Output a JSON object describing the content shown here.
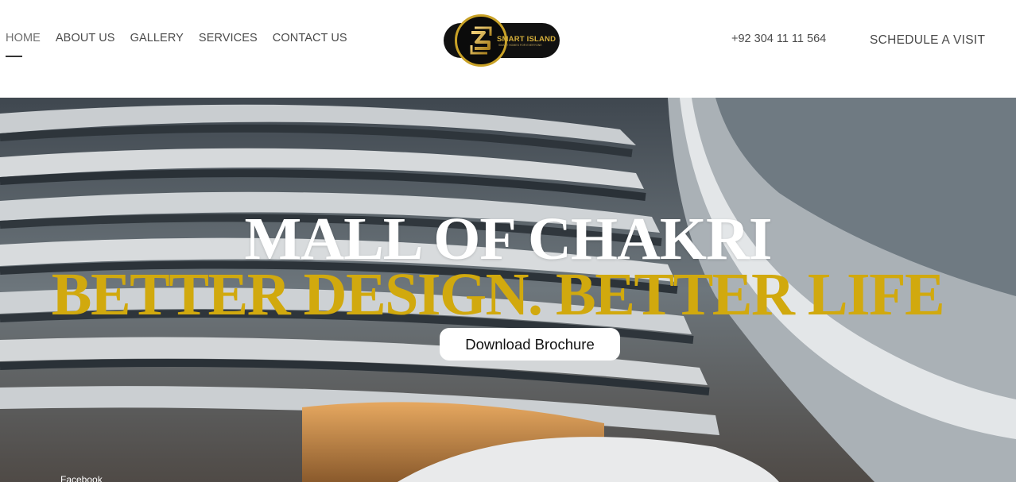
{
  "nav": {
    "items": [
      {
        "label": "HOME",
        "active": true
      },
      {
        "label": "ABOUT US",
        "active": false
      },
      {
        "label": "GALLERY",
        "active": false
      },
      {
        "label": "SERVICES",
        "active": false
      },
      {
        "label": "CONTACT US",
        "active": false
      }
    ]
  },
  "logo": {
    "name": "SMART ISLAND",
    "tagline": "SMART HOMES FOR EVERYONE",
    "icon": "smart-island-logo-icon"
  },
  "header": {
    "phone": "+92 304 11 11 564",
    "cta_label": "SCHEDULE A VISIT"
  },
  "hero": {
    "title": "MALL OF CHAKRI",
    "subtitle": "BETTER DESIGN. BETTER LIFE",
    "button_label": "Download Brochure",
    "social_label": "Facebook"
  },
  "colors": {
    "accent_gold": "#d1a90e",
    "text_dark": "#4a4a4a",
    "logo_bg": "#111111"
  }
}
